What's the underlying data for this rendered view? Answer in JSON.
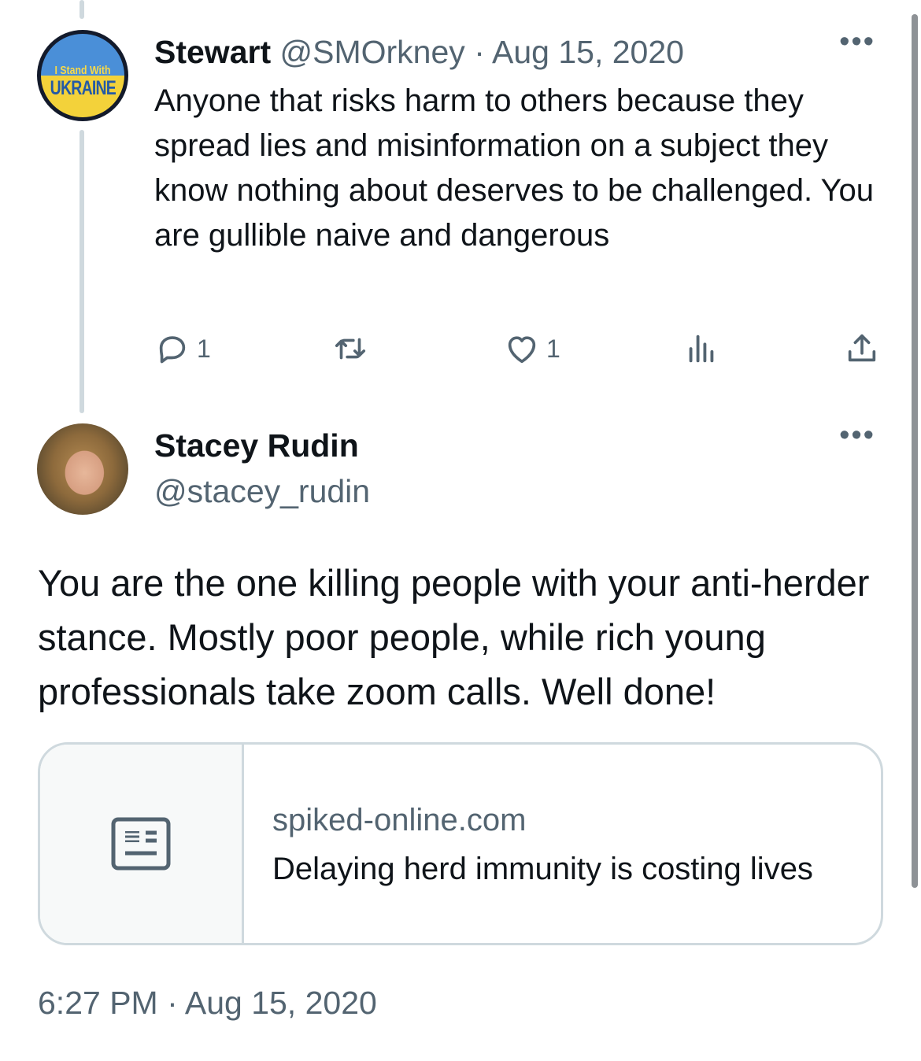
{
  "reply_tweet": {
    "avatar": {
      "line1": "I Stand With",
      "line2": "UKRAINE"
    },
    "name": "Stewart",
    "handle": "@SMOrkney",
    "separator": "·",
    "date": "Aug 15, 2020",
    "text": "Anyone that risks harm to others because they spread lies and misinformation on a subject they know nothing about deserves to be challenged. You are gullible naive and dangerous",
    "actions": {
      "reply_count": "1",
      "retweet_count": "",
      "like_count": "1",
      "views_count": ""
    }
  },
  "main_tweet": {
    "name": "Stacey Rudin",
    "handle": "@stacey_rudin",
    "text": "You are the one killing people with your anti-herder stance. Mostly poor people, while rich young professionals take zoom calls. Well done!",
    "link_card": {
      "domain": "spiked-online.com",
      "title": "Delaying herd immunity is costing lives"
    },
    "timestamp": "6:27 PM · Aug 15, 2020"
  },
  "icons": {
    "reply": "reply-icon",
    "retweet": "retweet-icon",
    "like": "heart-icon",
    "views": "analytics-icon",
    "share": "share-icon",
    "more": "more-icon",
    "article": "article-icon"
  },
  "colors": {
    "text": "#0f1419",
    "muted": "#536471",
    "border": "#cfd9de",
    "ukraine_blue": "#4a8fd8",
    "ukraine_yellow": "#f3d23a"
  }
}
